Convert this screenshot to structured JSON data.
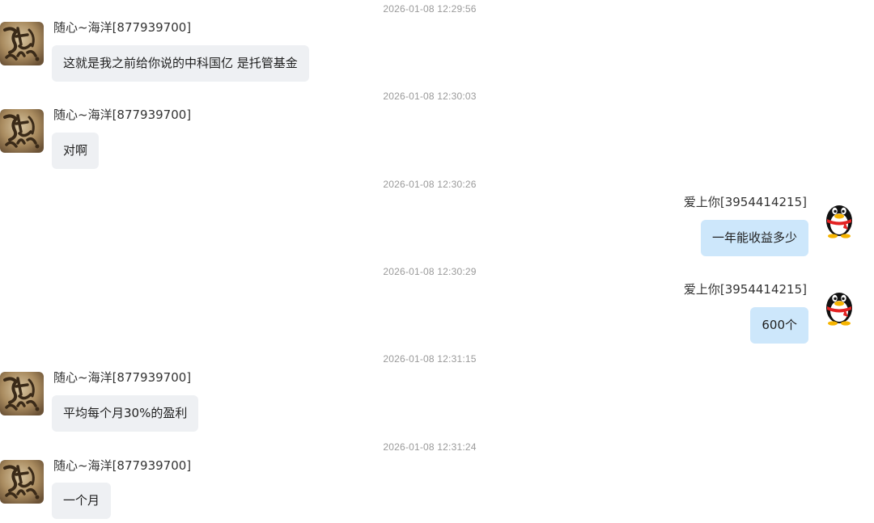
{
  "messages": [
    {
      "timestamp": "2026-01-08 12:29:56",
      "sender": "随心~海洋[877939700]",
      "direction": "incoming",
      "avatar_icon": "calligraphy-avatar-icon",
      "text": "这就是我之前给你说的中科国亿 是托管基金"
    },
    {
      "timestamp": "2026-01-08 12:30:03",
      "sender": "随心~海洋[877939700]",
      "direction": "incoming",
      "avatar_icon": "calligraphy-avatar-icon",
      "text": "对啊"
    },
    {
      "timestamp": "2026-01-08 12:30:26",
      "sender": "爱上你[3954414215]",
      "direction": "outgoing",
      "avatar_icon": "qq-penguin-icon",
      "text": "一年能收益多少"
    },
    {
      "timestamp": "2026-01-08 12:30:29",
      "sender": "爱上你[3954414215]",
      "direction": "outgoing",
      "avatar_icon": "qq-penguin-icon",
      "text": "600个"
    },
    {
      "timestamp": "2026-01-08 12:31:15",
      "sender": "随心~海洋[877939700]",
      "direction": "incoming",
      "avatar_icon": "calligraphy-avatar-icon",
      "text": "平均每个月30%的盈利"
    },
    {
      "timestamp": "2026-01-08 12:31:24",
      "sender": "随心~海洋[877939700]",
      "direction": "incoming",
      "avatar_icon": "calligraphy-avatar-icon",
      "text": "一个月"
    }
  ],
  "colors": {
    "incoming_bubble": "#eef0f3",
    "outgoing_bubble": "#cde7fb",
    "timestamp": "#9a9a9a"
  }
}
